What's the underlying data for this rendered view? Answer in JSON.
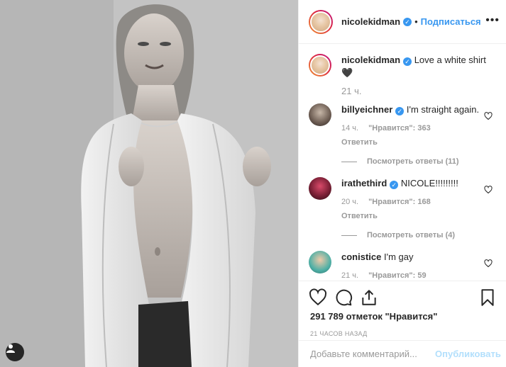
{
  "post": {
    "author": "nicolekidman",
    "follow_label": "Подписаться",
    "more_label": "•••",
    "caption": "Love a white shirt 🖤",
    "caption_time": "21 ч."
  },
  "comments": [
    {
      "user": "billyeichner",
      "verified": true,
      "text": "I'm straight again.",
      "time": "14 ч.",
      "likes": "\"Нравится\": 363",
      "reply": "Ответить",
      "view_replies": "Посмотреть ответы (11)"
    },
    {
      "user": "irathethird",
      "verified": true,
      "text": "NICOLE!!!!!!!!!",
      "time": "20 ч.",
      "likes": "\"Нравится\": 168",
      "reply": "Ответить",
      "view_replies": "Посмотреть ответы (4)"
    },
    {
      "user": "conistice",
      "verified": false,
      "text": "I'm gay",
      "time": "21 ч.",
      "likes": "\"Нравится\": 59"
    }
  ],
  "stats": {
    "likes": "291 789 отметок \"Нравится\"",
    "timestamp": "21 ЧАСОВ НАЗАД"
  },
  "add_comment": {
    "placeholder": "Добавьте комментарий...",
    "publish": "Опубликовать"
  },
  "colors": {
    "accent": "#3897f0",
    "publish_disabled": "#b2dffc",
    "muted": "#999999"
  },
  "icons": [
    "heart-icon",
    "comment-icon",
    "share-icon",
    "bookmark-icon",
    "user-tag-icon",
    "verified-badge-icon"
  ]
}
